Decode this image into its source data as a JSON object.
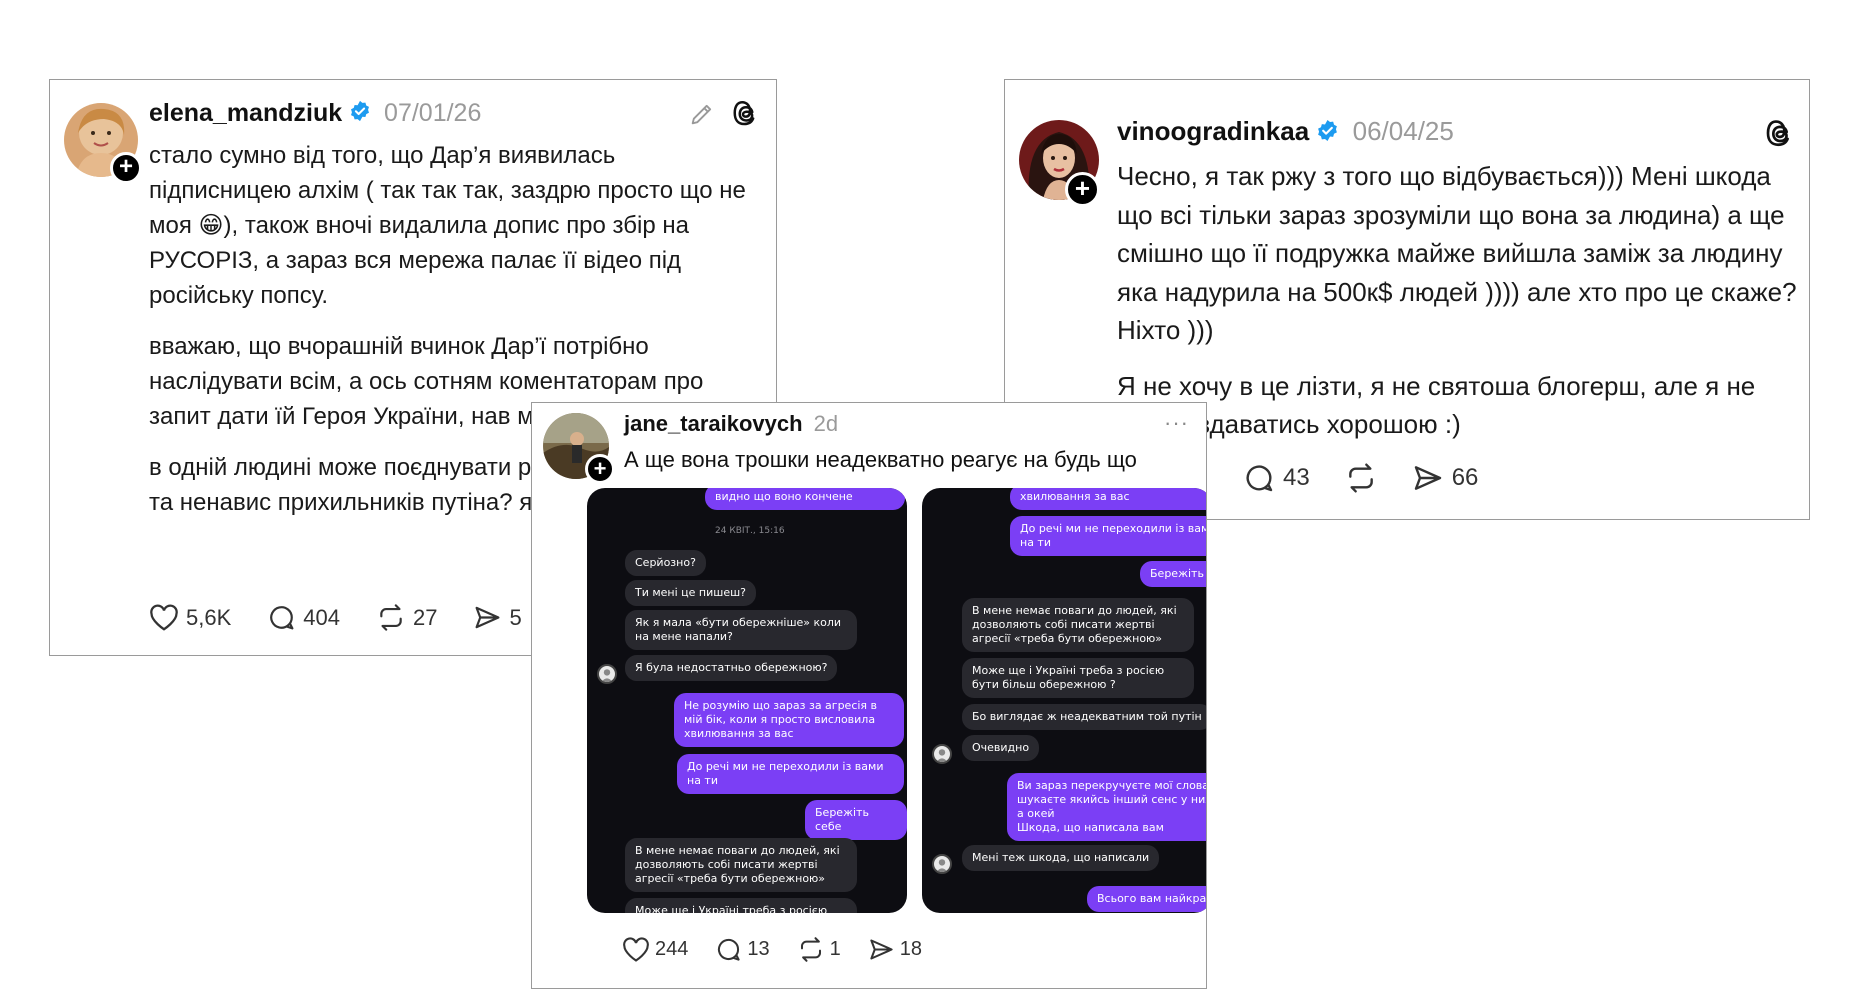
{
  "posts": [
    {
      "username": "elena_mandziuk",
      "date": "07/01/26",
      "paragraphs": [
        "стало сумно від того, що Дар’я виявилась підписницею алхім ( так так так, заздрю просто що не моя 😁), також вночі видалила допис про збір на РУСОРІЗ, а зараз вся мережа палає її відео під російську попсу.",
        "вважаю, що вчорашній вчинок Дар’ї потрібно наслідувати всім, а ось сотням коментаторам про запит дати їй Героя України, нав мислити.",
        "в одній людині може поєднувати російською культури та ненавис прихильників путіна? як ви гада"
      ],
      "likes": "5,6K",
      "replies": "404",
      "reposts": "27",
      "shares": "5"
    },
    {
      "username": "vinoogradinkaa",
      "date": "06/04/25",
      "paragraphs": [
        "Чесно, я так ржу з того що відбувається))) Мені шкода що всі тільки зараз зрозуміли що вона за людина) а ще смішно що її подружка майже вийшла заміж за людину яка надурила на 500к$ людей )))) але хто про це скаже? Ніхто )))",
        "Я не хочу в це лізти, я не святоша блогерш, але я не хотіла здаватись хорошою :)"
      ],
      "replies": "43",
      "shares": "66"
    },
    {
      "username": "jane_taraikovych",
      "date": "2d",
      "text": "А ще вона трошки неадекватно реагує на будь що",
      "likes": "244",
      "replies": "13",
      "reposts": "1",
      "shares": "18",
      "more": "···"
    }
  ],
  "chat1": {
    "top": "видно що воно кончене",
    "timestamp": "24 КВІТ., 15:16",
    "m1": "Серйозно?",
    "m2": "Ти мені це пишеш?",
    "m3": "Як я мала «бути обережніше» коли на мене напали?",
    "m4": "Я була недостатньо обережною?",
    "m5": "Не розумію що зараз за агресія в мій бік, коли я просто висловила хвилювання за вас",
    "m6": "До речі ми не переходили із вами на ти",
    "m7": "Бережіть себе",
    "m8": "В мене немає поваги до людей, які дозволяють собі писати жертві агресії «треба бути обережною»",
    "m9": "Може ще і Україні треба з росією бути"
  },
  "chat2": {
    "m1": "хвилювання за вас",
    "m2": "До речі ми не переходили із вами на ти",
    "m3": "Бережіть се",
    "m4": "В мене немає поваги до людей, які дозволяють собі писати жертві агресії «треба бути обережною»",
    "m5": "Може ще і Україні треба з росією бути більш обережною ?",
    "m6": "Бо виглядає ж неадекватним той путін",
    "m7": "Очевидно",
    "m8": "Ви зараз перекручуєте мої слова і шукаєте якийсь інший сенс у них, а окей\nШкода, що написала вам",
    "m9": "Мені теж шкода, що написали",
    "m10": "Всього вам найкращ"
  },
  "colors": {
    "verified": "#1d9bf0",
    "chat_out": "#7b3ff5",
    "chat_in": "#28282e",
    "chat_bg": "#0d0d12"
  }
}
